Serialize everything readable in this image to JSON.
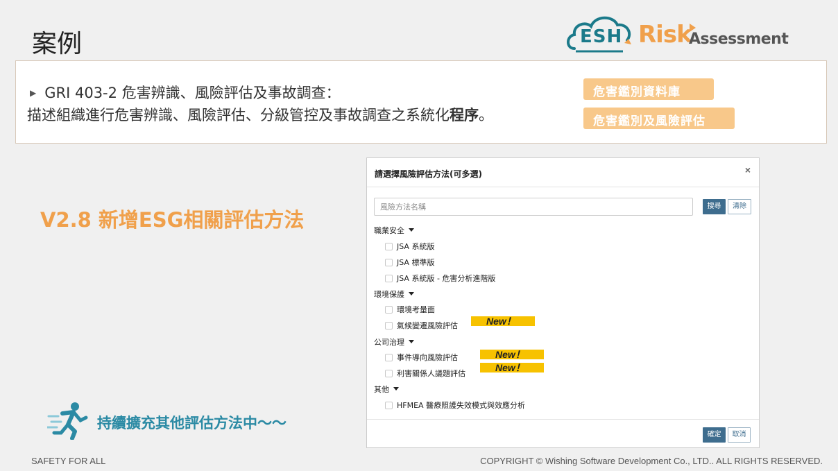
{
  "slide": {
    "title": "案例",
    "headline": "V2.8 新增ESG相關評估方法",
    "ongoing": "持續擴充其他評估方法中～～",
    "footer_left": "SAFETY FOR ALL",
    "footer_right": "COPYRIGHT © Wishing Software Development Co., LTD.. ALL RIGHTS RESERVED."
  },
  "logo": {
    "esh": "ESH",
    "risk": "Risk",
    "assessment": "Assessment"
  },
  "info": {
    "line1": "GRI 403-2 危害辨識、風險評估及事故調查：",
    "line2_prefix": "描述組織進行危害辨識、風險評估、分級管控及事故調查之系統化",
    "line2_bold": "程序",
    "line2_suffix": "。",
    "tag1": "危害鑑別資料庫",
    "tag2": "危害鑑別及風險評估"
  },
  "modal": {
    "title": "請選擇風險評估方法(可多選)",
    "close": "×",
    "search_placeholder": "風險方法名稱",
    "search_label": "搜尋",
    "clear_label": "清除",
    "ok_label": "確定",
    "cancel_label": "取消",
    "new_label": "New！",
    "groups": [
      {
        "label": "職業安全",
        "items": [
          "JSA 系統版",
          "JSA 標準版",
          "JSA 系統版 - 危害分析進階版"
        ]
      },
      {
        "label": "環境保護",
        "items": [
          "環境考量面",
          "氣候變遷風險評估"
        ]
      },
      {
        "label": "公司治理",
        "items": [
          "事件導向風險評估",
          "利害關係人議題評估"
        ]
      },
      {
        "label": "其他",
        "items": [
          "HFMEA 醫療照護失效模式與效應分析"
        ]
      }
    ]
  },
  "colors": {
    "accent_orange": "#f0a04b",
    "tag_orange": "#f8c88a",
    "teal": "#2b8aa4",
    "new_yellow": "#f7c200",
    "button_blue": "#3e6d8e"
  }
}
